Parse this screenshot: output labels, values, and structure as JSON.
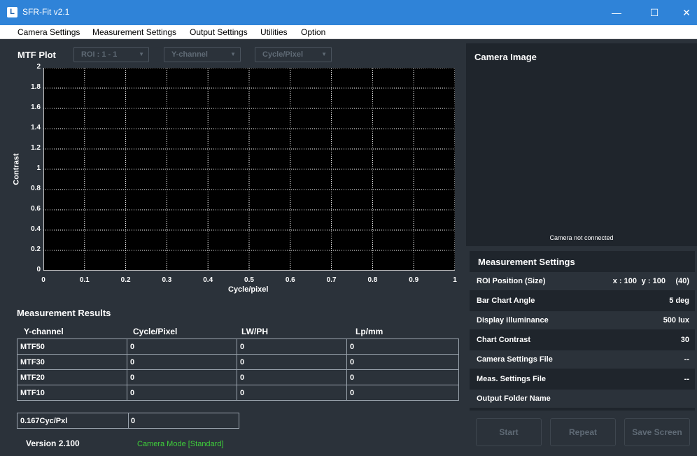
{
  "window": {
    "icon_letter": "L",
    "title": "SFR-Fit v2.1",
    "minimize": "—",
    "maximize": "☐",
    "close": "✕"
  },
  "menu": [
    "Camera Settings",
    "Measurement Settings",
    "Output Settings",
    "Utilities",
    "Option"
  ],
  "mtf": {
    "title": "MTF Plot",
    "roi_select": "ROI : 1 - 1",
    "channel_select": "Y-channel",
    "unit_select": "Cycle/Pixel"
  },
  "chart_data": {
    "type": "line",
    "title": "",
    "xlabel": "Cycle/pixel",
    "ylabel": "Contrast",
    "xlim": [
      0,
      1
    ],
    "ylim": [
      0,
      2
    ],
    "x_ticks": [
      "0",
      "0.1",
      "0.2",
      "0.3",
      "0.4",
      "0.5",
      "0.6",
      "0.7",
      "0.8",
      "0.9",
      "1"
    ],
    "y_ticks": [
      "0",
      "0.2",
      "0.4",
      "0.6",
      "0.8",
      "1",
      "1.2",
      "1.4",
      "1.6",
      "1.8",
      "2"
    ],
    "grid": true,
    "series": []
  },
  "results": {
    "title": "Measurement Results",
    "headers": [
      "Y-channel",
      "Cycle/Pixel",
      "LW/PH",
      "Lp/mm"
    ],
    "rows": [
      [
        "MTF50",
        "0",
        "0",
        "0"
      ],
      [
        "MTF30",
        "0",
        "0",
        "0"
      ],
      [
        "MTF20",
        "0",
        "0",
        "0"
      ],
      [
        "MTF10",
        "0",
        "0",
        "0"
      ]
    ],
    "cyc_label": "0.167Cyc/Pxl",
    "cyc_value": "0"
  },
  "footer": {
    "version": "Version 2.100",
    "camera_mode": "Camera Mode [Standard]"
  },
  "camera": {
    "title": "Camera Image",
    "status": "Camera not connected"
  },
  "settings": {
    "title": "Measurement Settings",
    "roi_key": "ROI Position (Size)",
    "roi_x": "x : 100",
    "roi_y": "y : 100",
    "roi_size": "(40)",
    "rows": [
      {
        "k": "Bar Chart Angle",
        "v": "5 deg"
      },
      {
        "k": "Display illuminance",
        "v": "500 lux"
      },
      {
        "k": "Chart Contrast",
        "v": "30"
      },
      {
        "k": "Camera Settings File",
        "v": "--"
      },
      {
        "k": "Meas. Settings File",
        "v": "--"
      },
      {
        "k": "Output Folder Name",
        "v": ""
      }
    ]
  },
  "buttons": {
    "start": "Start",
    "repeat": "Repeat",
    "save": "Save Screen"
  },
  "colors": {
    "titlebar": "#2f83d8",
    "background": "#2b323a",
    "panel": "#1f252c",
    "camera_mode_text": "#3fcf3a"
  }
}
